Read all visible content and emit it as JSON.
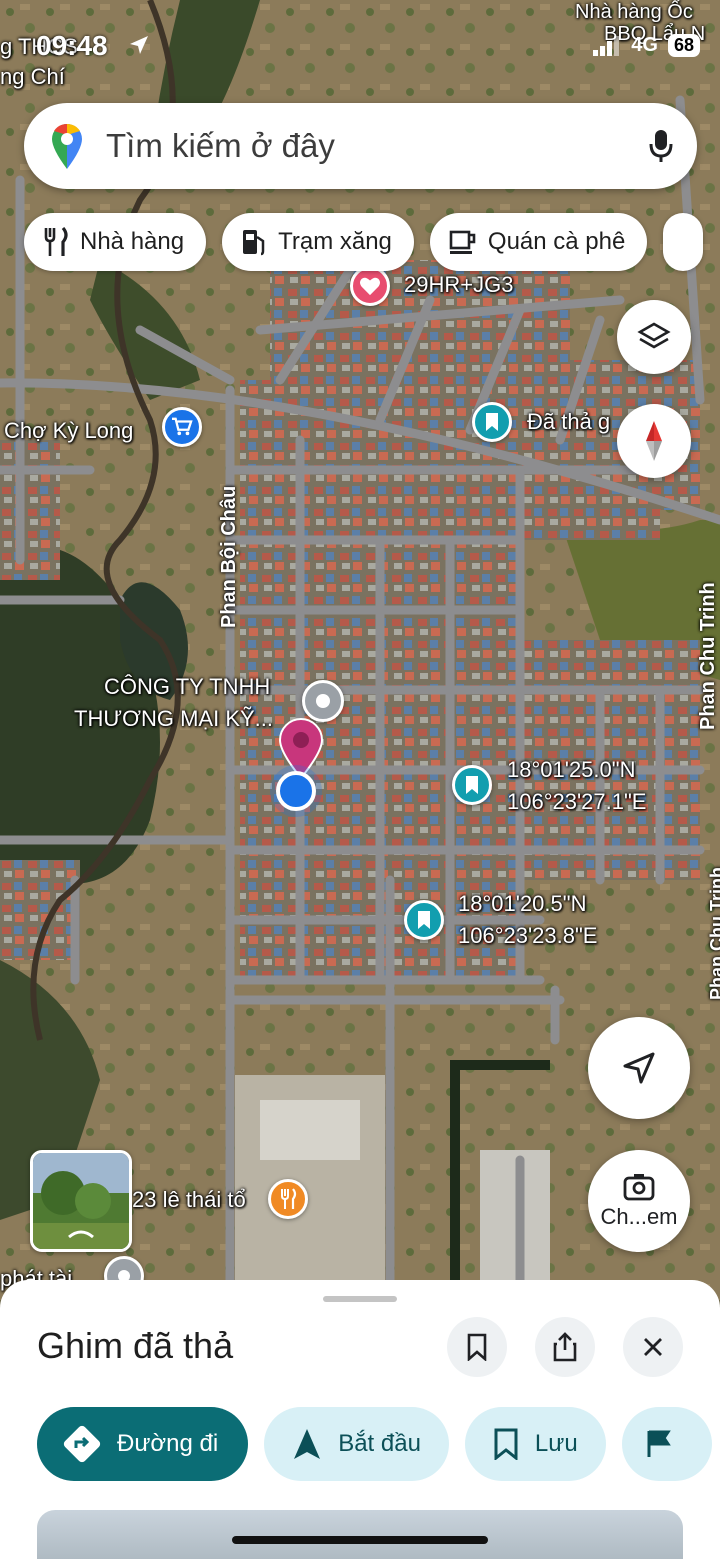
{
  "status_bar": {
    "time": "09:48",
    "network": "4G",
    "battery": "68"
  },
  "search": {
    "placeholder": "Tìm kiếm ở đây"
  },
  "chips": [
    {
      "label": "Nhà hàng",
      "icon": "restaurant-icon"
    },
    {
      "label": "Trạm xăng",
      "icon": "gas-station-icon"
    },
    {
      "label": "Quán cà phê",
      "icon": "coffee-icon"
    }
  ],
  "map": {
    "labels": {
      "top_left_1": "g THCS",
      "top_left_2": "ng Chí",
      "top_right": "Nhà hàng Ốc",
      "top_right_2": "BBQ Lẩu N",
      "plus_code": "29HR+JG3",
      "market": "Chợ Kỳ Long",
      "dropped_pin": "Đã thả g",
      "street_phan_boi_chau": "Phan Bội Châu",
      "street_phan_chu_trinh": "Phan Chu Trinh",
      "street_phan_chu_trinh_2": "Phan Chu Trinh",
      "company_1": "CÔNG TY TNHH",
      "company_2": "THƯƠNG MẠI KỸ...",
      "coord1_lat": "18°01'25.0\"N",
      "coord1_lng": "106°23'27.1\"E",
      "coord2_lat": "18°01'20.5\"N",
      "coord2_lng": "106°23'23.8\"E",
      "restaurant": "23 lê thái tổ",
      "bottom_left": "phát tài"
    },
    "lens_label": "Ch...em"
  },
  "sheet": {
    "title": "Ghim đã thả",
    "actions": [
      {
        "label": "Đường đi"
      },
      {
        "label": "Bắt đầu"
      },
      {
        "label": "Lưu"
      }
    ]
  },
  "colors": {
    "accent": "#0b6d75",
    "action_bg": "#d8f0f6",
    "pin_red": "#d5366f",
    "saved_pin": "#129eaf"
  }
}
